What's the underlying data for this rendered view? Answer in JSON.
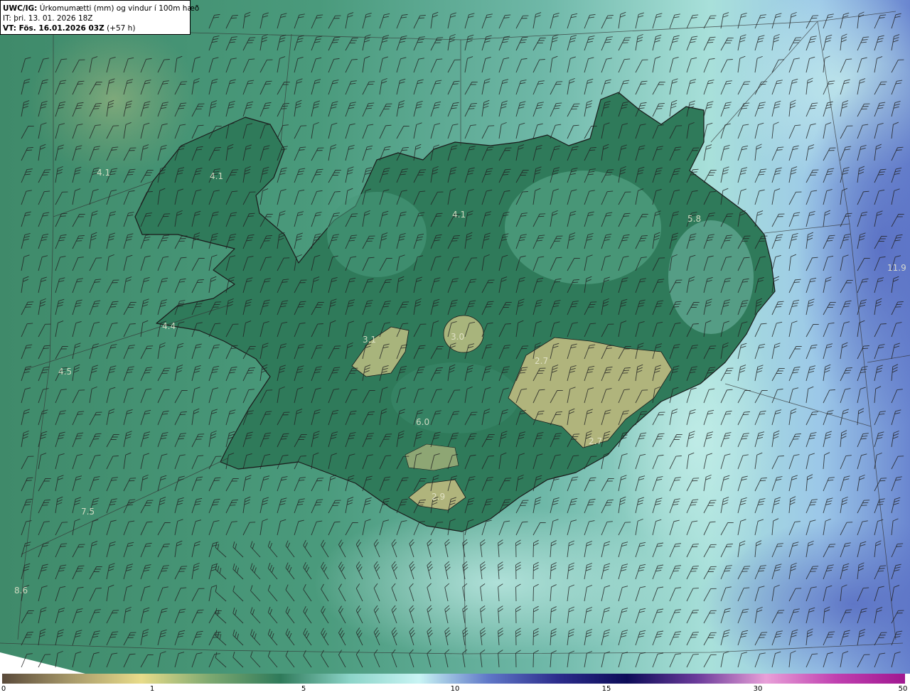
{
  "header": {
    "model": "UWC/IG:",
    "title": "Úrkomumætti (mm) og vindur í 100m hæð",
    "it_line": "IT: þri. 13. 01. 2026 18Z",
    "vt_label": "VT: Fös. 16.01.2026 03Z",
    "vt_offset": "(+57 h)"
  },
  "values": [
    {
      "text": "4.1",
      "region": "northwest-sea"
    },
    {
      "text": "4.1",
      "region": "westfjords"
    },
    {
      "text": "4.1",
      "region": "north"
    },
    {
      "text": "5.8",
      "region": "northeast"
    },
    {
      "text": "11.9",
      "region": "east-sea"
    },
    {
      "text": "4.4",
      "region": "snaefellsnes"
    },
    {
      "text": "4.5",
      "region": "west-sea"
    },
    {
      "text": "3.1",
      "region": "langjokull"
    },
    {
      "text": "3.0",
      "region": "hofsjokull"
    },
    {
      "text": "2.7",
      "region": "vatnajokull"
    },
    {
      "text": "6.0",
      "region": "highlands"
    },
    {
      "text": "2.7",
      "region": "oraefajokull"
    },
    {
      "text": "2.9",
      "region": "myrdalsjokull"
    },
    {
      "text": "7.5",
      "region": "southwest-sea"
    },
    {
      "text": "8.6",
      "region": "far-southwest-sea"
    }
  ],
  "colorbar": {
    "ticks": [
      "0",
      "1",
      "5",
      "10",
      "15",
      "30",
      "50"
    ],
    "colors": [
      "#5a4a3a",
      "#a89a6a",
      "#e8dc8a",
      "#7ca870",
      "#2f7a5a",
      "#8cd4c8",
      "#c8f4f4",
      "#6078c8",
      "#2c2c8c",
      "#0c0c58",
      "#6a3a9a",
      "#e8a0d8",
      "#c040b0",
      "#a01890"
    ]
  }
}
